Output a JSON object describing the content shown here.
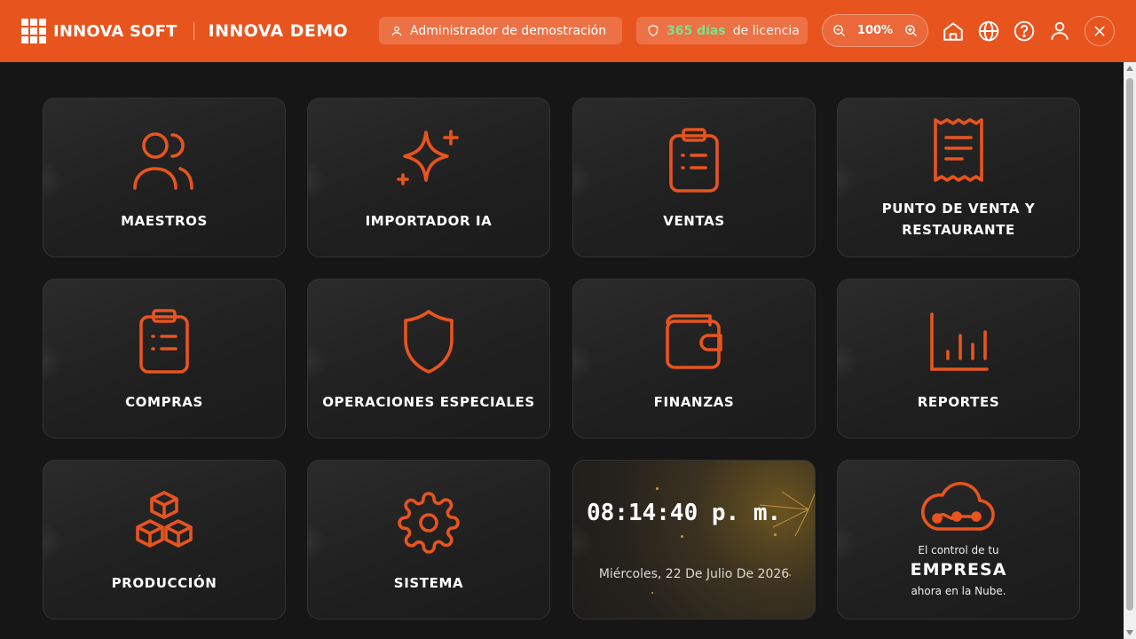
{
  "header": {
    "brand": "INNOVA SOFT",
    "company": "INNOVA DEMO",
    "user": "Administrador de demostración",
    "license_days": "365 días",
    "license_suffix": "de licencia",
    "zoom": "100%",
    "icons": [
      "grid-logo-icon",
      "user-icon",
      "shield-icon",
      "zoom-out-icon",
      "zoom-in-icon",
      "home-icon",
      "globe-icon",
      "help-icon",
      "profile-icon",
      "close-icon"
    ]
  },
  "colors": {
    "header_bg": "#e8541e",
    "accent": "#e8541e",
    "license_green": "#7ee08a",
    "page_bg": "#161616",
    "tile_bg": "#242424"
  },
  "modules": [
    {
      "label": "MAESTROS",
      "icon": "users-icon"
    },
    {
      "label": "IMPORTADOR IA",
      "icon": "sparkle-icon"
    },
    {
      "label": "VENTAS",
      "icon": "clipboard-icon"
    },
    {
      "label": "PUNTO DE VENTA Y RESTAURANTE",
      "icon": "receipt-icon"
    },
    {
      "label": "COMPRAS",
      "icon": "clipboard-list-icon"
    },
    {
      "label": "OPERACIONES ESPECIALES",
      "icon": "shield-icon"
    },
    {
      "label": "FINANZAS",
      "icon": "wallet-icon"
    },
    {
      "label": "REPORTES",
      "icon": "bar-chart-icon"
    },
    {
      "label": "PRODUCCIÓN",
      "icon": "boxes-icon"
    },
    {
      "label": "SISTEMA",
      "icon": "gear-icon"
    }
  ],
  "clock": {
    "time": "08:14:40 p. m.",
    "date": "Miércoles, 22 De Julio De 2026"
  },
  "cloud": {
    "sub": "El control de tu",
    "big": "EMPRESA",
    "foot": "ahora en la Nube.",
    "icon": "cloud-icon"
  }
}
